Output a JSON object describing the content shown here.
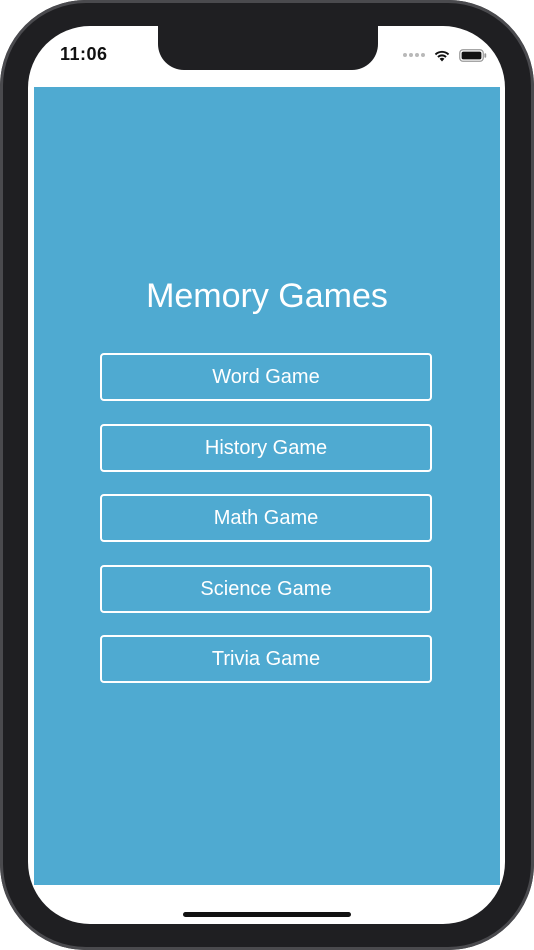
{
  "status_bar": {
    "time": "11:06",
    "icons": [
      "cellular-signal-icon",
      "wifi-icon",
      "battery-icon"
    ]
  },
  "app": {
    "title": "Memory Games",
    "background_color": "#4faad1",
    "buttons": [
      {
        "label": "Word Game"
      },
      {
        "label": "History Game"
      },
      {
        "label": "Math Game"
      },
      {
        "label": "Science Game"
      },
      {
        "label": "Trivia Game"
      }
    ]
  }
}
